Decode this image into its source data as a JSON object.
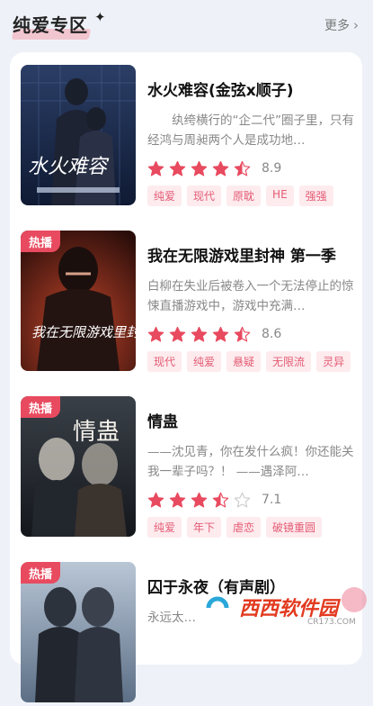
{
  "header": {
    "title": "纯爱专区",
    "more_label": "更多",
    "sparkle_icon": "sparkle-icon",
    "more_icon": "chevron-right-icon"
  },
  "colors": {
    "accent": "#e84a5f",
    "star_on": "#e84a5f",
    "star_off": "#cccccc",
    "tag_bg": "#fdebee",
    "tag_text": "#e45c74"
  },
  "items": [
    {
      "title": "水火难容(金弦x顺子)",
      "desc": "　　纨绔横行的“企二代”圈子里，只有经鸿与周昶两个人是成功地…",
      "rating": 4.5,
      "score": "8.9",
      "tags": [
        "纯爱",
        "现代",
        "原耽",
        "HE",
        "强强"
      ],
      "hot": false,
      "cover_text": "水火难容"
    },
    {
      "title": "我在无限游戏里封神 第一季",
      "desc": "白柳在失业后被卷入一个无法停止的惊悚直播游戏中，游戏中充满…",
      "rating": 4.5,
      "score": "8.6",
      "tags": [
        "现代",
        "纯爱",
        "悬疑",
        "无限流",
        "灵异"
      ],
      "hot": true,
      "hot_label": "热播",
      "cover_text": "我在无限游戏里封神"
    },
    {
      "title": "情蛊",
      "desc": "——沈见青，你在发什么疯！你还能关我一辈子吗？！ ——遇泽阿…",
      "rating": 3.5,
      "score": "7.1",
      "tags": [
        "纯爱",
        "年下",
        "虐恋",
        "破镜重圆"
      ],
      "hot": true,
      "hot_label": "热播",
      "cover_text": "情蛊"
    },
    {
      "title": "囚于永夜（有声剧）",
      "desc": "永远太…",
      "hot": true,
      "hot_label": "热播"
    }
  ],
  "watermark": {
    "text": "西西软件园",
    "sub": "CR173.COM"
  }
}
